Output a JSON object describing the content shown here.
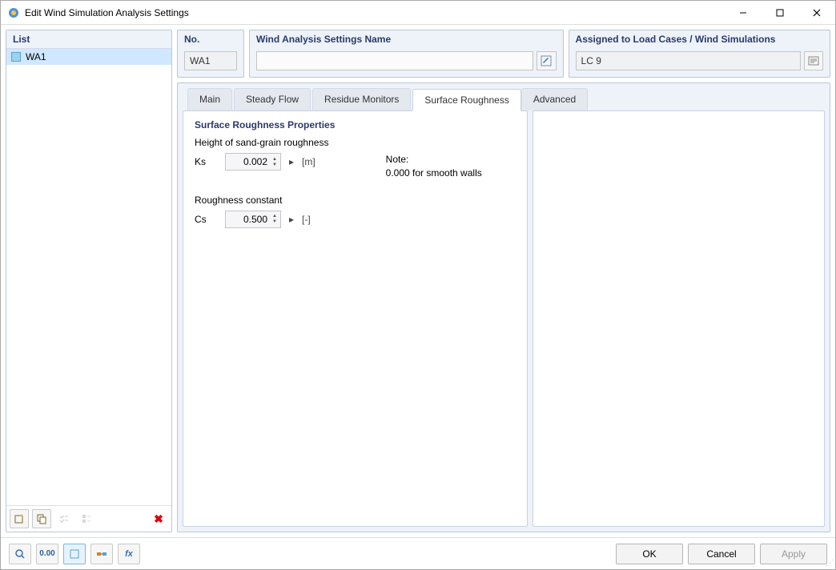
{
  "titlebar": {
    "title": "Edit Wind Simulation Analysis Settings"
  },
  "leftpanel": {
    "header": "List",
    "items": [
      {
        "label": "WA1"
      }
    ]
  },
  "panels": {
    "no": {
      "header": "No.",
      "value": "WA1"
    },
    "name": {
      "header": "Wind Analysis Settings Name",
      "value": ""
    },
    "assign": {
      "header": "Assigned to Load Cases / Wind Simulations",
      "value": "LC 9"
    }
  },
  "tabs": {
    "items": [
      "Main",
      "Steady Flow",
      "Residue Monitors",
      "Surface Roughness",
      "Advanced"
    ],
    "active": "Surface Roughness"
  },
  "content": {
    "section_title": "Surface Roughness Properties",
    "height_label": "Height of sand-grain roughness",
    "ks_label": "Ks",
    "ks_value": "0.002",
    "ks_unit": "[m]",
    "note_label": "Note:",
    "note_text": "0.000 for smooth walls",
    "roughness_label": "Roughness constant",
    "cs_label": "Cs",
    "cs_value": "0.500",
    "cs_unit": "[-]"
  },
  "buttons": {
    "ok": "OK",
    "cancel": "Cancel",
    "apply": "Apply"
  },
  "toolbar_icons": {
    "new": "new-icon",
    "copy": "copy-icon",
    "checklist": "checklist-icon",
    "props": "properties-icon",
    "delete": "delete-icon",
    "search": "search-icon",
    "decimal": "decimal-icon",
    "box": "box-icon",
    "link": "link-icon",
    "fx": "fx-icon",
    "edit": "edit-icon",
    "details": "details-icon"
  }
}
